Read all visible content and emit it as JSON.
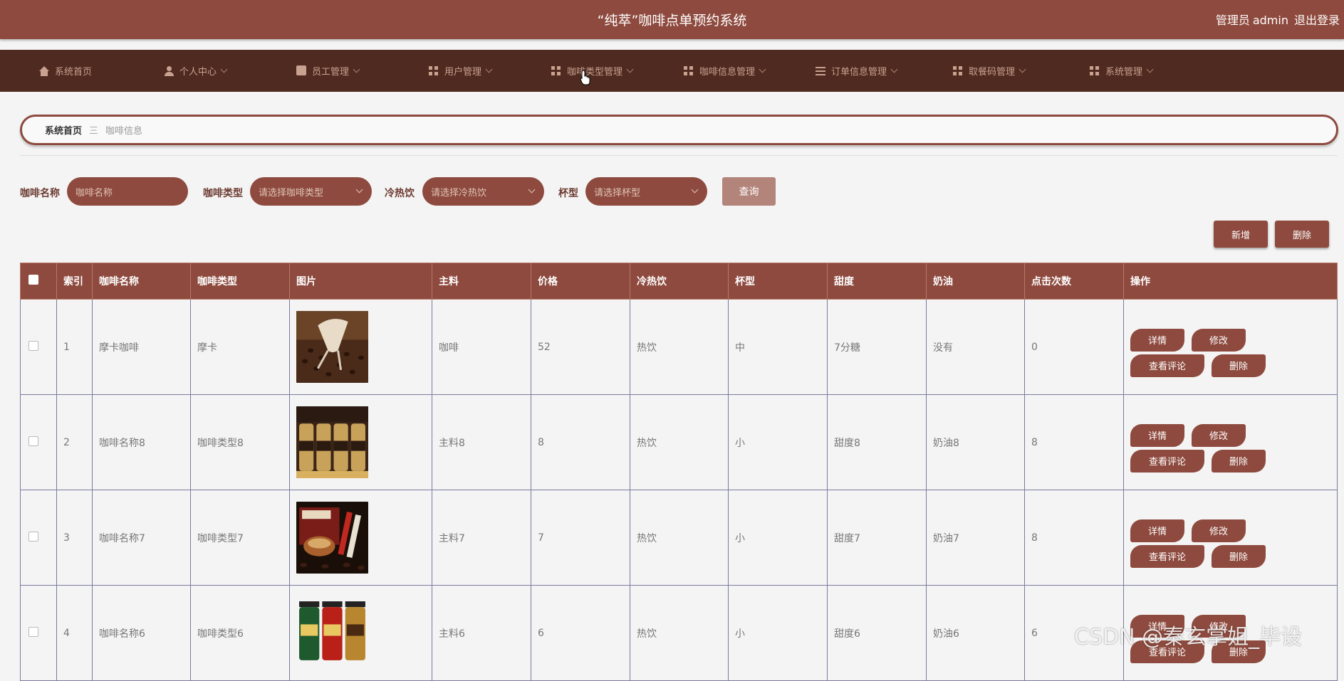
{
  "header": {
    "title": "“纯萃”咖啡点单预约系统",
    "user_role": "管理员",
    "username": "admin",
    "logout": "退出登录"
  },
  "nav": {
    "items": [
      {
        "label": "系统首页",
        "icon": "home-icon"
      },
      {
        "label": "个人中心",
        "icon": "user-icon"
      },
      {
        "label": "员工管理",
        "icon": "chat-icon"
      },
      {
        "label": "用户管理",
        "icon": "grid-icon"
      },
      {
        "label": "咖啡类型管理",
        "icon": "grid-icon"
      },
      {
        "label": "咖啡信息管理",
        "icon": "grid-icon"
      },
      {
        "label": "订单信息管理",
        "icon": "list-icon"
      },
      {
        "label": "取餐码管理",
        "icon": "grid-icon"
      },
      {
        "label": "系统管理",
        "icon": "grid-icon"
      }
    ]
  },
  "breadcrumb": {
    "home": "系统首页",
    "separator": "三",
    "current": "咖啡信息"
  },
  "filters": {
    "name_label": "咖啡名称",
    "name_placeholder": "咖啡名称",
    "type_label": "咖啡类型",
    "type_placeholder": "请选择咖啡类型",
    "temp_label": "冷热饮",
    "temp_placeholder": "请选择冷热饮",
    "cup_label": "杯型",
    "cup_placeholder": "请选择杯型",
    "query": "查询"
  },
  "actions": {
    "add": "新增",
    "delete": "删除"
  },
  "table": {
    "headers": [
      "索引",
      "咖啡名称",
      "咖啡类型",
      "图片",
      "主料",
      "价格",
      "冷热饮",
      "杯型",
      "甜度",
      "奶油",
      "点击次数",
      "操作"
    ],
    "rows": [
      {
        "index": "1",
        "name": "摩卡咖啡",
        "type": "摩卡",
        "image": "coffee-beans-cup",
        "main": "咖啡",
        "price": "52",
        "temp": "热饮",
        "cup": "中",
        "sweet": "7分糖",
        "cream": "没有",
        "clicks": "0"
      },
      {
        "index": "2",
        "name": "咖啡名称8",
        "type": "咖啡类型8",
        "image": "canned-coffee",
        "main": "主料8",
        "price": "8",
        "temp": "热饮",
        "cup": "小",
        "sweet": "甜度8",
        "cream": "奶油8",
        "clicks": "8"
      },
      {
        "index": "3",
        "name": "咖啡名称7",
        "type": "咖啡类型7",
        "image": "instant-coffee-box",
        "main": "主料7",
        "price": "7",
        "temp": "热饮",
        "cup": "小",
        "sweet": "甜度7",
        "cream": "奶油7",
        "clicks": "8"
      },
      {
        "index": "4",
        "name": "咖啡名称6",
        "type": "咖啡类型6",
        "image": "coffee-jars",
        "main": "主料6",
        "price": "6",
        "temp": "热饮",
        "cup": "小",
        "sweet": "甜度6",
        "cream": "奶油6",
        "clicks": "6"
      }
    ],
    "row_ops": {
      "detail": "详情",
      "edit": "修改",
      "comments": "查看评论",
      "delete": "删除"
    }
  },
  "watermark": "CSDN @秦玄掌姐_毕设"
}
